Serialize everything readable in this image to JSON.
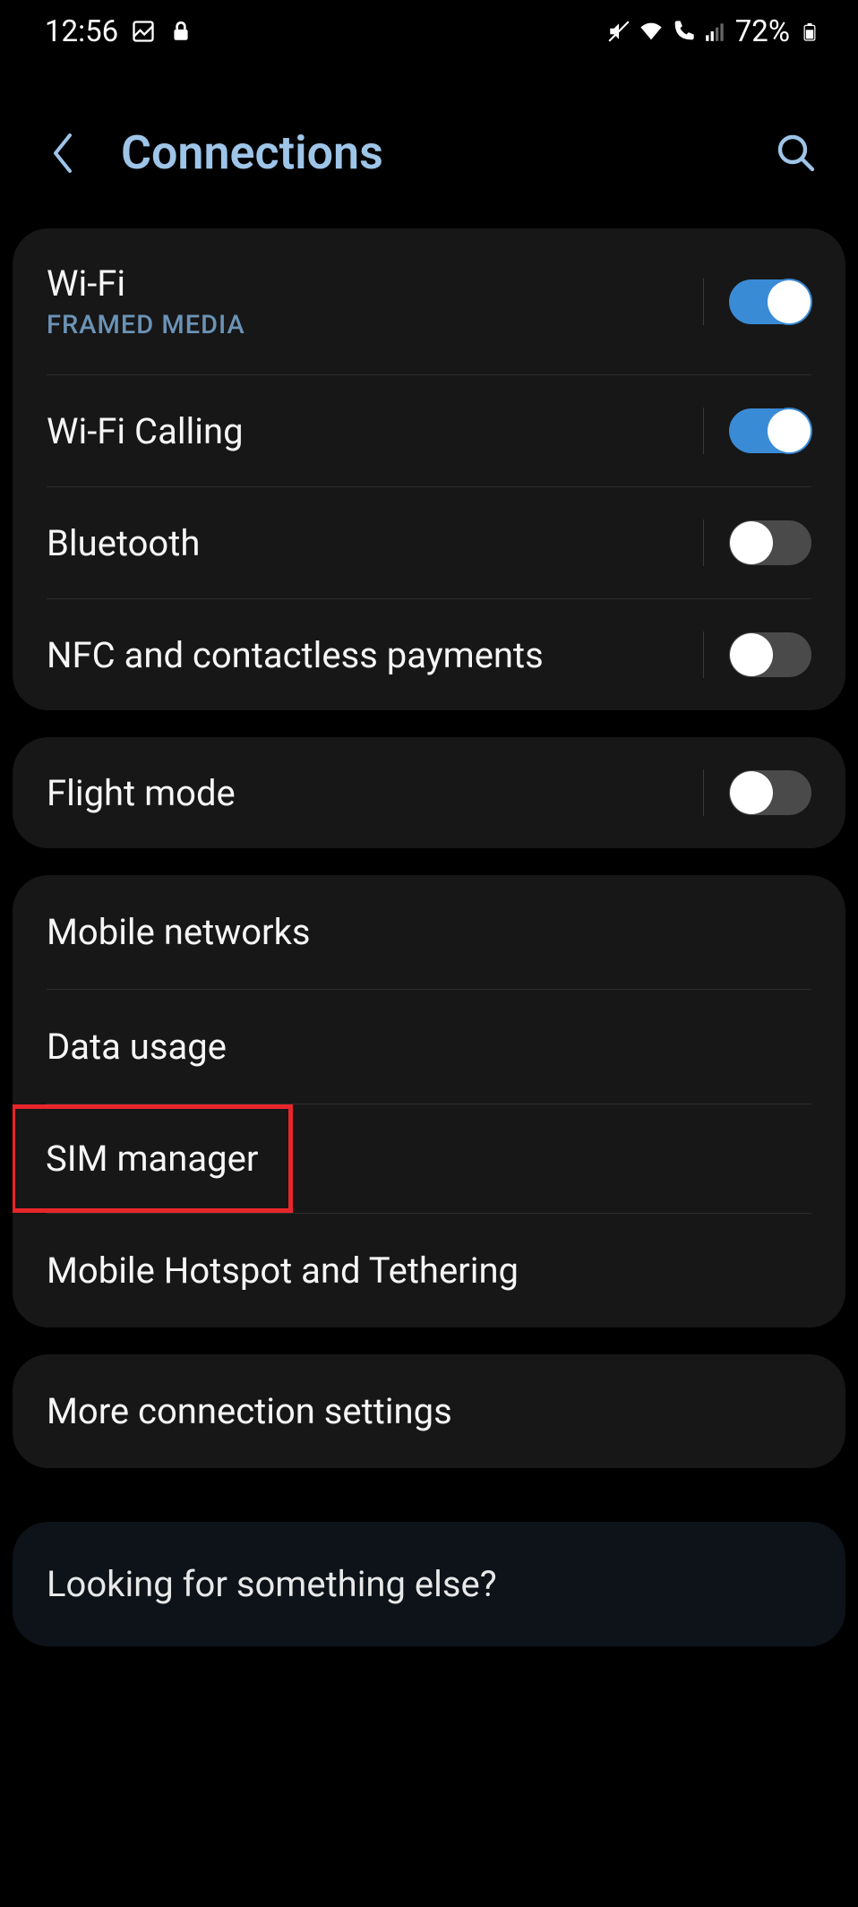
{
  "statusbar": {
    "time": "12:56",
    "battery": "72%"
  },
  "header": {
    "title": "Connections"
  },
  "groups": [
    {
      "rows": [
        {
          "title": "Wi-Fi",
          "subtitle": "FRAMED MEDIA",
          "toggle": true,
          "state": "on"
        },
        {
          "title": "Wi-Fi Calling",
          "toggle": true,
          "state": "on"
        },
        {
          "title": "Bluetooth",
          "toggle": true,
          "state": "off"
        },
        {
          "title": "NFC and contactless payments",
          "toggle": true,
          "state": "off"
        }
      ]
    },
    {
      "rows": [
        {
          "title": "Flight mode",
          "toggle": true,
          "state": "off"
        }
      ]
    },
    {
      "rows": [
        {
          "title": "Mobile networks"
        },
        {
          "title": "Data usage"
        },
        {
          "title": "SIM manager",
          "highlighted": true
        },
        {
          "title": "Mobile Hotspot and Tethering"
        }
      ]
    },
    {
      "rows": [
        {
          "title": "More connection settings"
        }
      ]
    }
  ],
  "footer": {
    "text": "Looking for something else?"
  }
}
